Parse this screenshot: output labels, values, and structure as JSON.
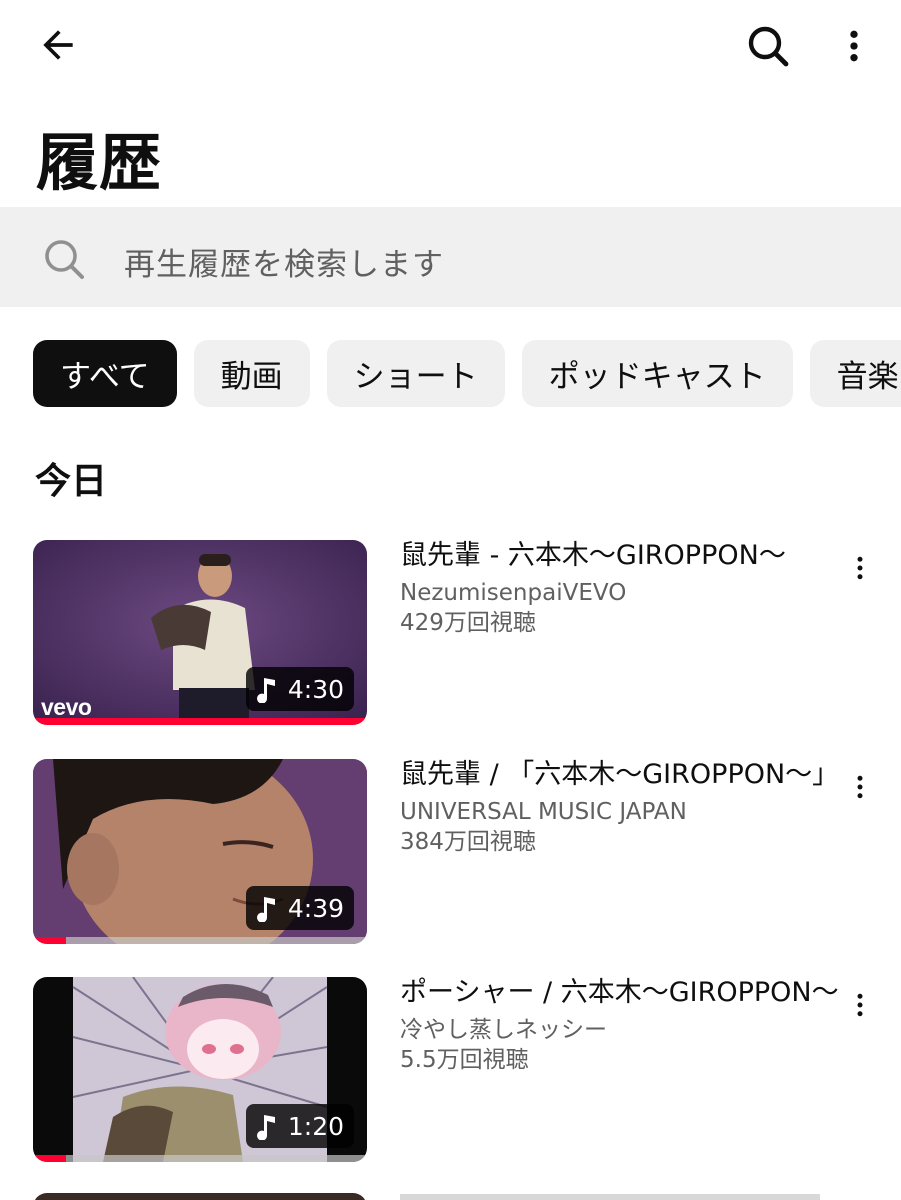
{
  "header": {
    "back_icon": "arrow-left-icon",
    "search_icon": "search-icon",
    "more_icon": "more-vert-icon"
  },
  "page": {
    "title": "履歴"
  },
  "history_search": {
    "placeholder": "再生履歴を検索します",
    "icon": "search-icon"
  },
  "filters": [
    {
      "label": "すべて",
      "selected": true
    },
    {
      "label": "動画",
      "selected": false
    },
    {
      "label": "ショート",
      "selected": false
    },
    {
      "label": "ポッドキャスト",
      "selected": false
    },
    {
      "label": "音楽",
      "selected": false
    }
  ],
  "section": {
    "title": "今日"
  },
  "videos": [
    {
      "title": "鼠先輩 - 六本木〜GIROPPON〜",
      "channel": "NezumisenpaiVEVO",
      "views": "429万回視聴",
      "duration": "4:30",
      "watch_progress": 1.0,
      "badge": "vevo",
      "duration_icon": "music-note-icon"
    },
    {
      "title": "鼠先輩 / 「六本木〜GIROPPON〜」",
      "channel": "UNIVERSAL MUSIC JAPAN",
      "views": "384万回視聴",
      "duration": "4:39",
      "watch_progress": 0.1,
      "duration_icon": "music-note-icon"
    },
    {
      "title": "ポーシャー / 六本木〜GIROPPON〜",
      "channel": "冷やし蒸しネッシー",
      "views": "5.5万回視聴",
      "duration": "1:20",
      "watch_progress": 0.1,
      "duration_icon": "music-note-icon"
    }
  ],
  "colors": {
    "progress": "#ff0033",
    "chip_active_bg": "#0f0f0f",
    "chip_bg": "#f0f0f0",
    "secondary_text": "#606060"
  }
}
